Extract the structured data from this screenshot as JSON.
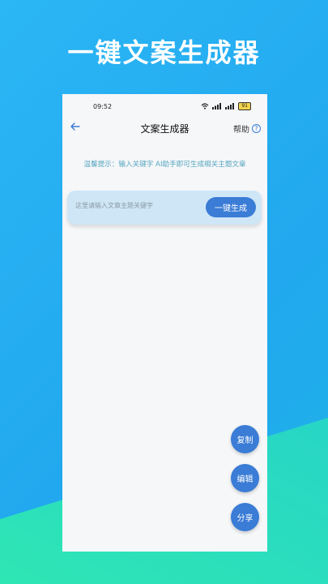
{
  "promo": {
    "title": "一键文案生成器"
  },
  "status_bar": {
    "time": "09:52",
    "battery": "91"
  },
  "nav": {
    "title": "文案生成器",
    "help_label": "帮助",
    "help_icon_glyph": "?"
  },
  "tip": {
    "text": "温馨提示：输入关键字 AI助手即可生成相关主题文章"
  },
  "search": {
    "placeholder": "这里请输入文章主题关键字",
    "button_label": "一键生成"
  },
  "actions": {
    "copy_label": "复制",
    "edit_label": "编辑",
    "share_label": "分享"
  },
  "colors": {
    "accent": "#3a7cd6",
    "background_top": "#23aef0",
    "background_bottom": "#2ee6b4",
    "tip_text": "#55a6c0"
  },
  "icons": {
    "back": "arrow-left-icon",
    "help": "question-circle-icon",
    "wifi": "wifi-icon",
    "signal": "signal-icon",
    "battery": "battery-icon"
  }
}
